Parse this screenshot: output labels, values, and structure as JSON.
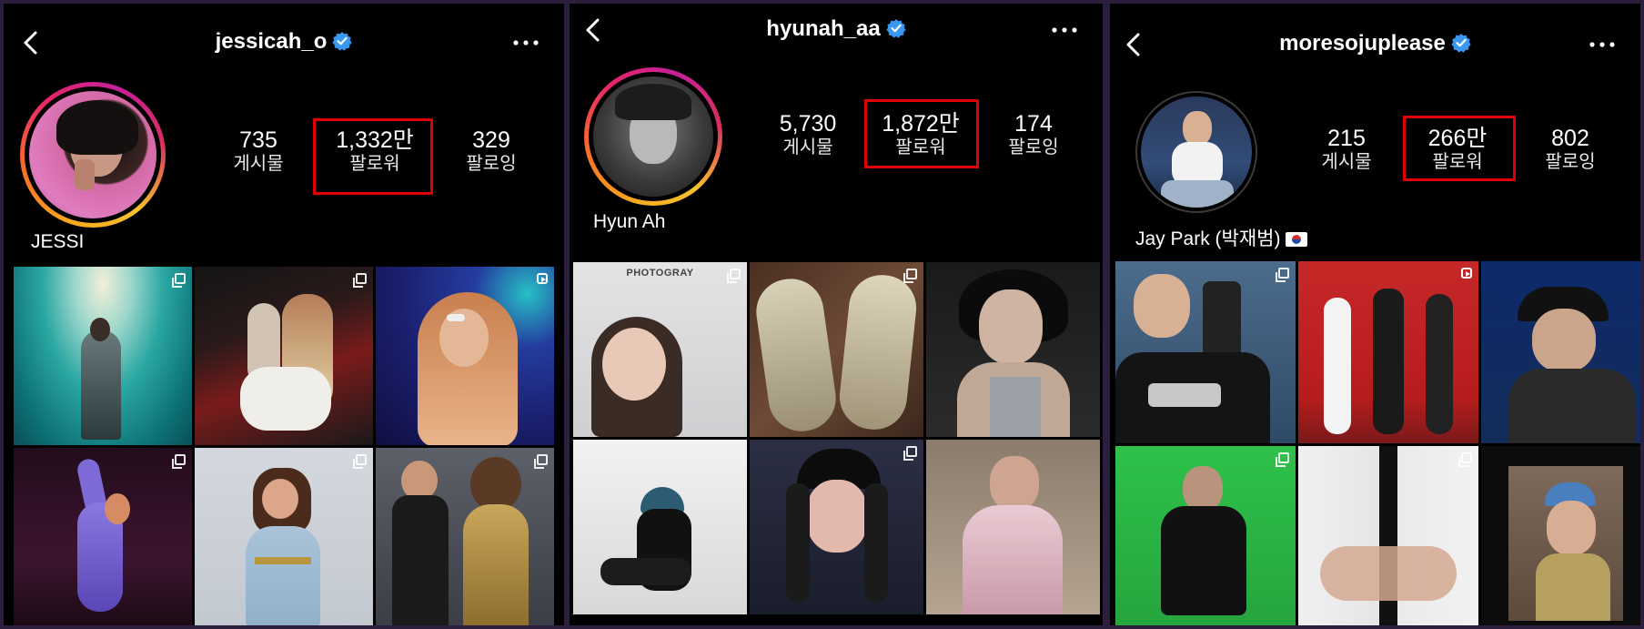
{
  "colors": {
    "highlight": "#e00000",
    "verified": "#3897f0",
    "background": "#000000",
    "frame": "#2b1f3d"
  },
  "profiles": [
    {
      "handle": "jessicah_o",
      "display_name": "JESSI",
      "stats": [
        {
          "value": "735",
          "label": "게시물"
        },
        {
          "value": "1,332만",
          "label": "팔로워"
        },
        {
          "value": "329",
          "label": "팔로잉"
        }
      ],
      "highlighted_stat": "팔로워",
      "tiles": [
        {
          "subject": "stage-performance-green",
          "badge": "multi"
        },
        {
          "subject": "couple-club-photo",
          "badge": "multi"
        },
        {
          "subject": "singing-microphone",
          "badge": "reel"
        },
        {
          "subject": "purple-stage-outfit",
          "badge": "multi"
        },
        {
          "subject": "white-dress-pose",
          "badge": "multi"
        },
        {
          "subject": "gold-dress-duo",
          "badge": "multi"
        }
      ]
    },
    {
      "handle": "hyunah_aa",
      "display_name": "Hyun Ah",
      "stats": [
        {
          "value": "5,730",
          "label": "게시물"
        },
        {
          "value": "1,872만",
          "label": "팔로워"
        },
        {
          "value": "174",
          "label": "팔로잉"
        }
      ],
      "highlighted_stat": "팔로워",
      "tiles": [
        {
          "subject": "photo-booth-selfie",
          "badge": "multi",
          "watermark": "PHOTOGRAY"
        },
        {
          "subject": "worn-sneakers",
          "badge": "multi"
        },
        {
          "subject": "wet-hair-portrait",
          "badge": "none"
        },
        {
          "subject": "bucket-hat-snow",
          "badge": "none"
        },
        {
          "subject": "black-cap-selfie",
          "badge": "multi"
        },
        {
          "subject": "car-seat-pink-jacket",
          "badge": "none"
        }
      ]
    },
    {
      "handle": "moresojuplease",
      "display_name": "Jay Park (박재범)",
      "stats": [
        {
          "value": "215",
          "label": "게시물"
        },
        {
          "value": "266만",
          "label": "팔로워"
        },
        {
          "value": "802",
          "label": "팔로잉"
        }
      ],
      "highlighted_stat": "팔로워",
      "tiles": [
        {
          "subject": "rolling-loud-phone",
          "badge": "multi"
        },
        {
          "subject": "red-backdrop-trio",
          "badge": "reel"
        },
        {
          "subject": "black-cap-earpiece",
          "badge": "none"
        },
        {
          "subject": "green-screen-performance",
          "badge": "multi"
        },
        {
          "subject": "hand-heart-shirt",
          "badge": "multi"
        },
        {
          "subject": "tongue-out-bottle",
          "badge": "none"
        }
      ]
    }
  ]
}
